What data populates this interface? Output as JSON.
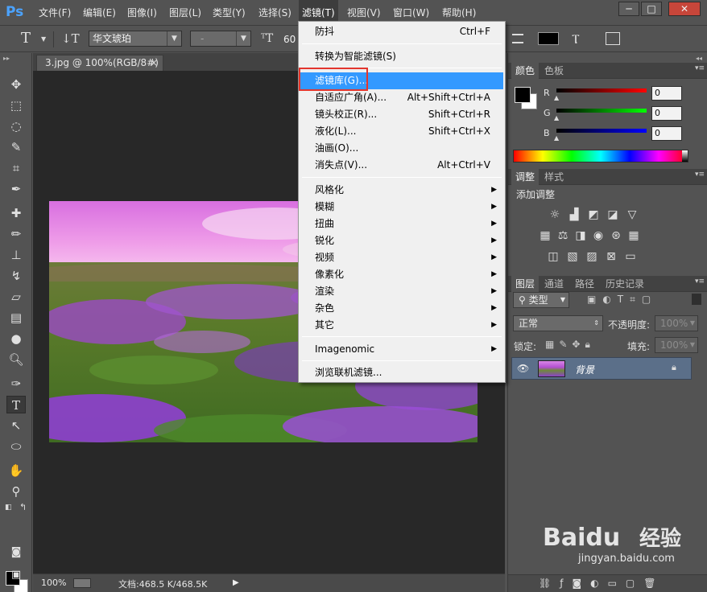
{
  "app": {
    "logo": "Ps"
  },
  "menubar": {
    "items": [
      "文件(F)",
      "编辑(E)",
      "图像(I)",
      "图层(L)",
      "类型(Y)",
      "选择(S)",
      "滤镜(T)",
      "视图(V)",
      "窗口(W)",
      "帮助(H)"
    ],
    "active_item": "滤镜(T)",
    "window_buttons": [
      "─",
      "□",
      "✕"
    ]
  },
  "options_bar": {
    "font_family": "华文琥珀",
    "font_style": "-",
    "font_size": "60"
  },
  "document": {
    "tab_title": "3.jpg @ 100%(RGB/8#)",
    "tab_close": "×",
    "zoom": "100%",
    "doc_info": "文档:468.5 K/468.5K"
  },
  "filter_menu": {
    "items": [
      {
        "label": "防抖",
        "shortcut": "Ctrl+F"
      },
      {
        "label": "转换为智能滤镜(S)",
        "shortcut": ""
      },
      {
        "label": "滤镜库(G)...",
        "shortcut": "",
        "highlighted": true
      },
      {
        "label": "自适应广角(A)...",
        "shortcut": "Alt+Shift+Ctrl+A"
      },
      {
        "label": "镜头校正(R)...",
        "shortcut": "Shift+Ctrl+R"
      },
      {
        "label": "液化(L)...",
        "shortcut": "Shift+Ctrl+X"
      },
      {
        "label": "油画(O)...",
        "shortcut": ""
      },
      {
        "label": "消失点(V)...",
        "shortcut": "Alt+Ctrl+V"
      },
      {
        "label": "风格化",
        "submenu": true
      },
      {
        "label": "模糊",
        "submenu": true
      },
      {
        "label": "扭曲",
        "submenu": true
      },
      {
        "label": "锐化",
        "submenu": true
      },
      {
        "label": "视频",
        "submenu": true
      },
      {
        "label": "像素化",
        "submenu": true
      },
      {
        "label": "渲染",
        "submenu": true
      },
      {
        "label": "杂色",
        "submenu": true
      },
      {
        "label": "其它",
        "submenu": true
      },
      {
        "label": "Imagenomic",
        "submenu": true
      },
      {
        "label": "浏览联机滤镜..."
      }
    ]
  },
  "color_panel": {
    "tabs": [
      "颜色",
      "色板"
    ],
    "channels": [
      {
        "label": "R",
        "value": "0",
        "color": "#ff0000"
      },
      {
        "label": "G",
        "value": "0",
        "color": "#00ff00"
      },
      {
        "label": "B",
        "value": "0",
        "color": "#0000ff"
      }
    ],
    "foreground": "#000000",
    "background": "#ffffff"
  },
  "adjustments_panel": {
    "tabs": [
      "调整",
      "样式"
    ],
    "title": "添加调整"
  },
  "layers_panel": {
    "tabs": [
      "图层",
      "通道",
      "路径",
      "历史记录"
    ],
    "filter_kind": "类型",
    "blend_mode": "正常",
    "opacity_label": "不透明度:",
    "opacity_value": "100%",
    "lock_label": "锁定:",
    "fill_label": "填充:",
    "fill_value": "100%",
    "layers": [
      {
        "name": "背景",
        "visible": true,
        "locked": true
      }
    ]
  },
  "watermark": {
    "brand": "Baidu",
    "text": "经验",
    "url": "jingyan.baidu.com"
  }
}
